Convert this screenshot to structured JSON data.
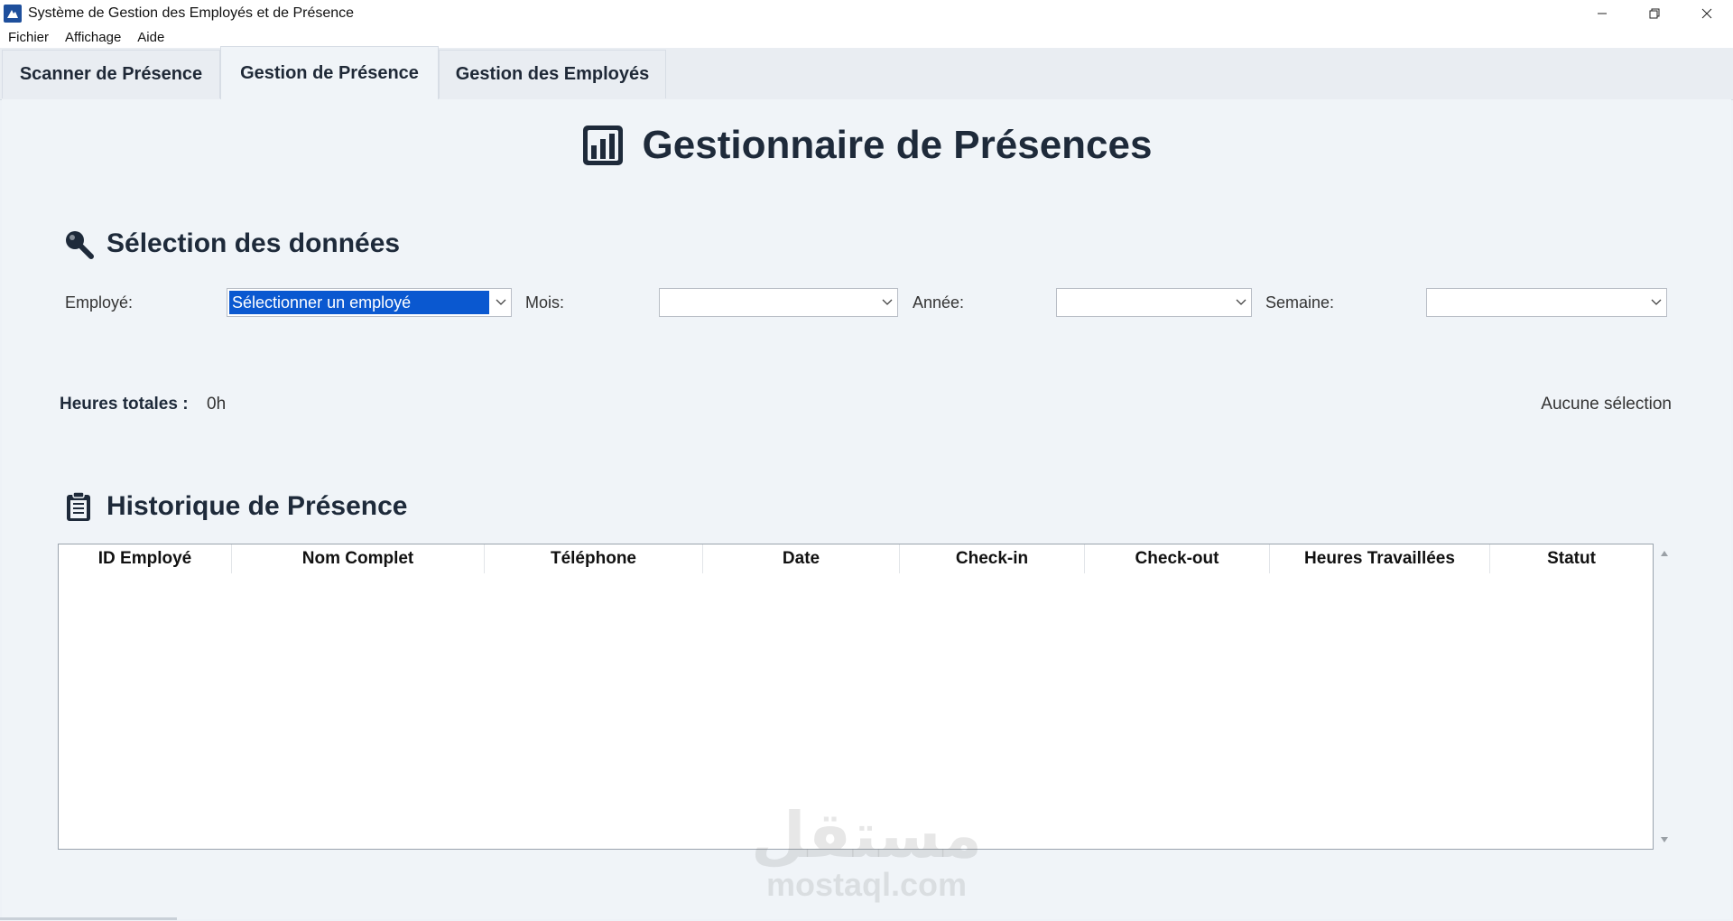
{
  "window": {
    "title": "Système de Gestion des Employés et de Présence",
    "controls": [
      "minimize-icon",
      "restore-icon",
      "close-icon"
    ]
  },
  "menu": {
    "items": [
      {
        "label": "Fichier"
      },
      {
        "label": "Affichage"
      },
      {
        "label": "Aide"
      }
    ]
  },
  "tabs": [
    {
      "label": "Scanner de Présence",
      "active": false
    },
    {
      "label": "Gestion de Présence",
      "active": true
    },
    {
      "label": "Gestion des Employés",
      "active": false
    }
  ],
  "page": {
    "title": "Gestionnaire de Présences",
    "title_icon": "bar-chart-icon"
  },
  "selection": {
    "title": "Sélection des données",
    "icon": "magnifier-icon",
    "employee_label": "Employé:",
    "employee_value": "Sélectionner un employé",
    "month_label": "Mois:",
    "month_value": "",
    "year_label": "Année:",
    "year_value": "",
    "week_label": "Semaine:",
    "week_value": ""
  },
  "totals": {
    "label": "Heures totales :",
    "value": "0h",
    "status": "Aucune sélection"
  },
  "history": {
    "title": "Historique de Présence",
    "icon": "clipboard-icon",
    "columns": [
      "ID Employé",
      "Nom Complet",
      "Téléphone",
      "Date",
      "Check-in",
      "Check-out",
      "Heures Travaillées",
      "Statut"
    ],
    "rows": []
  },
  "watermark": {
    "arabic": "مستقل",
    "latin": "mostaql.com"
  },
  "colors": {
    "background": "#f0f4f8",
    "heading": "#1e2a3a",
    "selection_highlight": "#0a58d0",
    "app_icon": "#1e4f9c"
  }
}
